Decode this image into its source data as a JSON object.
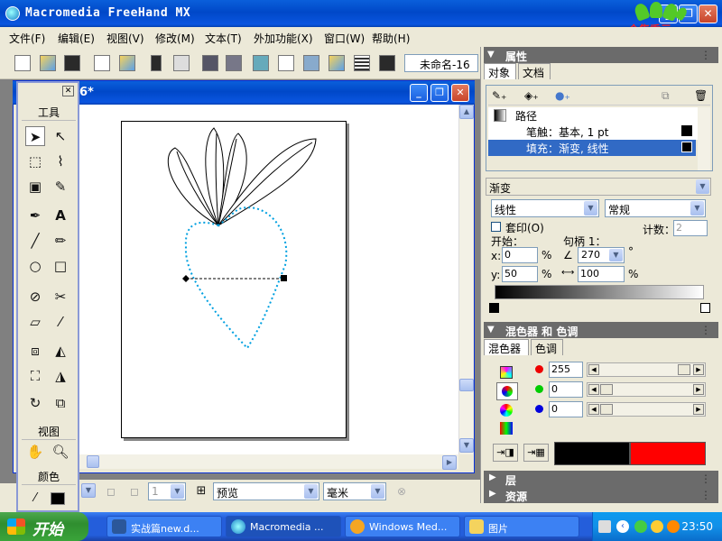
{
  "window": {
    "title": "Macromedia FreeHand MX"
  },
  "menu": [
    "文件(F)",
    "编辑(E)",
    "视图(V)",
    "修改(M)",
    "文本(T)",
    "外加功能(X)",
    "窗口(W)",
    "帮助(H)"
  ],
  "toolbar": {
    "doc_combo": "未命名-16"
  },
  "document": {
    "title": "6*"
  },
  "tools_panel": {
    "tools_header": "工具",
    "view_header": "视图",
    "color_header": "颜色"
  },
  "statusbar": {
    "page_num": "1",
    "preview_mode": "预览",
    "units": "毫米"
  },
  "properties": {
    "header": "属性",
    "tab_object": "对象",
    "tab_document": "文档",
    "path_label": "路径",
    "stroke_label": "笔触：基本, 1 pt",
    "fill_label": "填充：渐变, 线性",
    "fill_type": "渐变",
    "gradient_type": "线性",
    "gradient_mode": "常规",
    "overprint": "套印(O)",
    "count_label": "计数：",
    "count_value": "2",
    "start_label": "开始：",
    "handle_label": "句柄 1：",
    "x_label": "x:",
    "x_value": "0",
    "y_label": "y:",
    "y_value": "50",
    "percent": "%",
    "angle_value": "270",
    "degree": "°",
    "width_value": "100"
  },
  "mixer": {
    "header": "混色器 和 色调",
    "tab_mixer": "混色器",
    "tab_tint": "色调",
    "r": "255",
    "g": "0",
    "b": "0",
    "r_level": 1.0,
    "g_level": 0.0,
    "b_level": 0.0,
    "swatch_old": "#000000",
    "swatch_new": "#FF0000"
  },
  "layers_header": "层",
  "assets_header": "资源",
  "taskbar": {
    "start": "开始",
    "items": [
      "实战篇new.d...",
      "Macromedia ...",
      "Windows Med...",
      "图片"
    ],
    "clock": "23:50"
  },
  "colors": {
    "selection_blue": "#00A0E0",
    "title_blue": "#0A5FDB",
    "accent_red": "#FF0000"
  },
  "logo_text": "合集秀元"
}
